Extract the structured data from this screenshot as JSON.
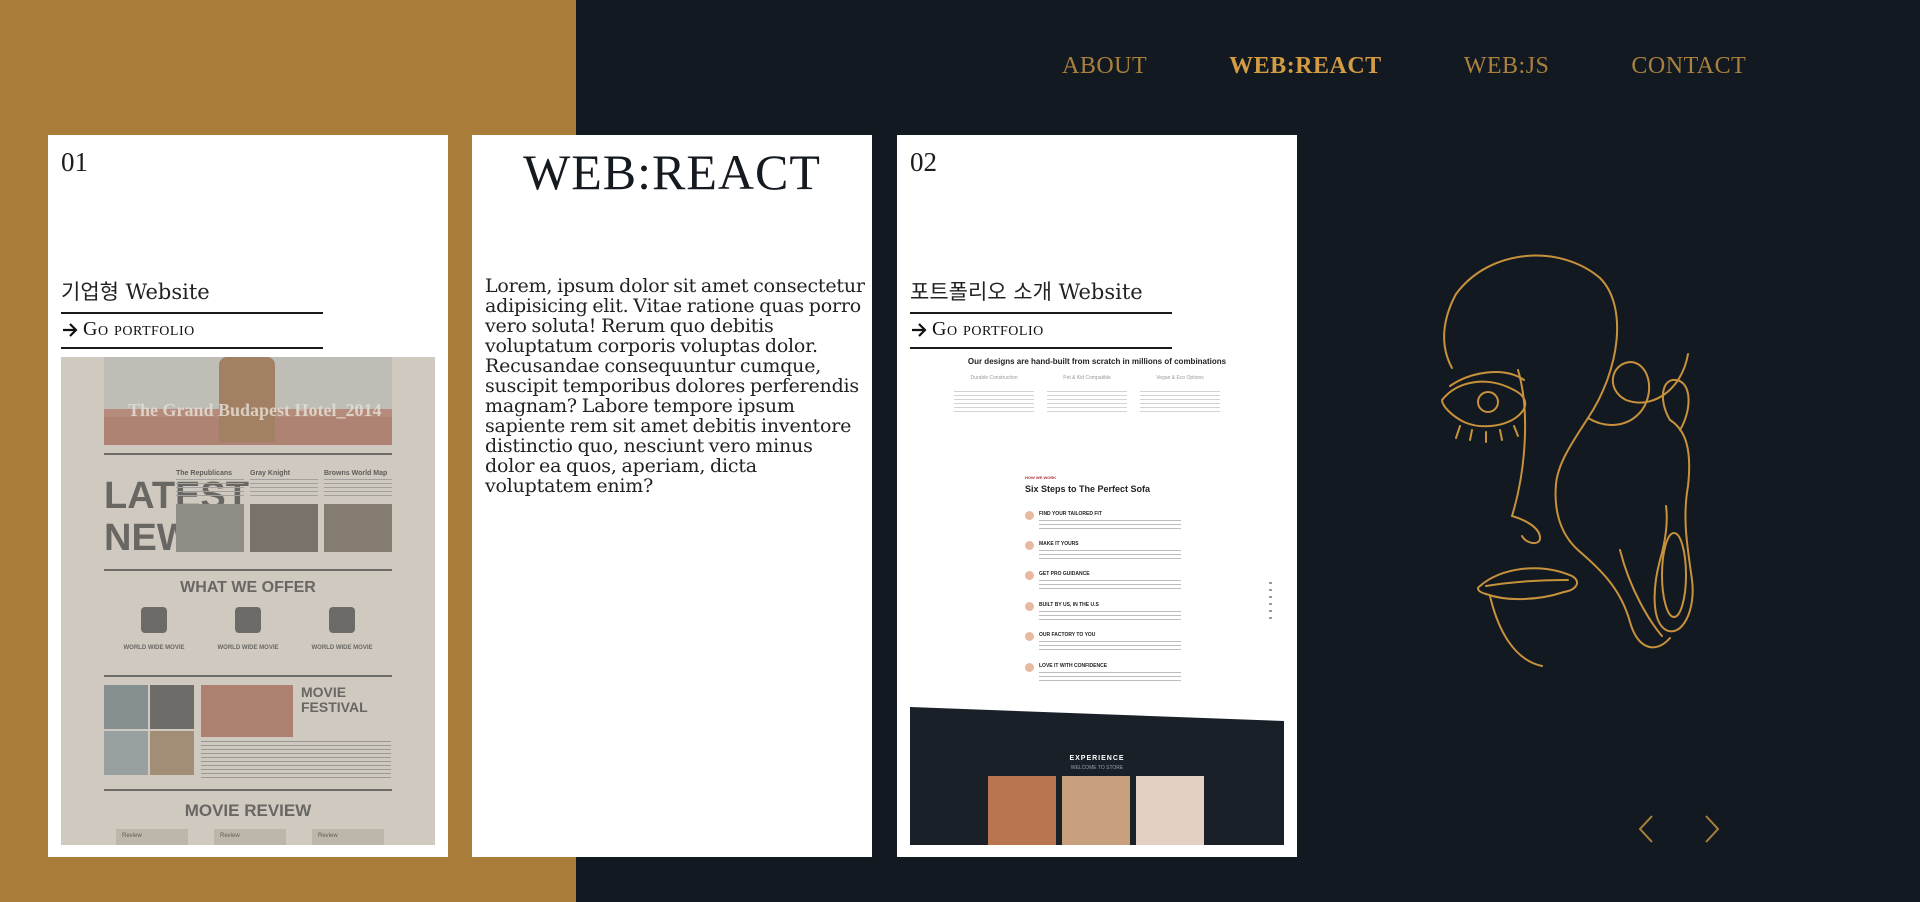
{
  "nav": {
    "items": [
      {
        "label": "ABOUT",
        "active": false
      },
      {
        "label": "WEB:REACT",
        "active": true
      },
      {
        "label": "WEB:JS",
        "active": false
      },
      {
        "label": "CONTACT",
        "active": false
      }
    ]
  },
  "cards": {
    "card1": {
      "number": "01",
      "title": "기업형 Website",
      "link_label": "Go portfolio",
      "screenshot": {
        "hero_title": "The Grand Budapest Hotel_2014",
        "latest": "LATEST NEWS",
        "news_titles": [
          "The Republicans",
          "Gray Knight",
          "Browns World Map"
        ],
        "offer_title": "WHAT WE OFFER",
        "offer_items": [
          "WORLD WIDE MOVIE",
          "WORLD WIDE MOVIE",
          "WORLD WIDE MOVIE"
        ],
        "festival_title": "MOVIE FESTIVAL",
        "review_title": "MOVIE REVIEW",
        "review_tabs": [
          "Review",
          "Review",
          "Review"
        ]
      }
    },
    "card2": {
      "title": "WEB:REACT",
      "body": "Lorem, ipsum dolor sit amet consectetur adipisicing elit. Vitae ratione quas porro vero soluta! Rerum quo debitis voluptatum corporis voluptas dolor. Recusandae consequuntur cumque, suscipit temporibus dolores perferendis magnam? Labore tempore ipsum sapiente rem sit amet debitis inventore distinctio quo, nesciunt vero minus dolor ea quos, aperiam, dicta voluptatem enim?"
    },
    "card3": {
      "number": "02",
      "title": "포트폴리오 소개 Website",
      "link_label": "Go portfolio",
      "screenshot": {
        "headline": "Our designs are hand-built from scratch in millions of combinations",
        "features": [
          "Durable Construction",
          "Pet & Kid Compatible",
          "Vegan & Eco Options"
        ],
        "tag": "HOW WE WORK",
        "steps_title": "Six Steps to The Perfect Sofa",
        "steps": [
          "FIND YOUR TAILORED FIT",
          "MAKE IT YOURS",
          "GET PRO GUIDANCE",
          "BUILT BY US, IN THE U.S",
          "OUR FACTORY TO YOU",
          "LOVE IT WITH CONFIDENCE"
        ],
        "experience_title": "EXPERIENCE",
        "experience_sub": "WELCOME TO STORE"
      }
    }
  },
  "colors": {
    "gold_panel": "#a97c3a",
    "dark_bg": "#121920",
    "nav_text": "#a9803d",
    "nav_active": "#d39c44",
    "line_art": "#c8923d"
  },
  "icons": {
    "link_arrow": "arrow-right-icon",
    "prev": "chevron-left-icon",
    "next": "chevron-right-icon"
  }
}
